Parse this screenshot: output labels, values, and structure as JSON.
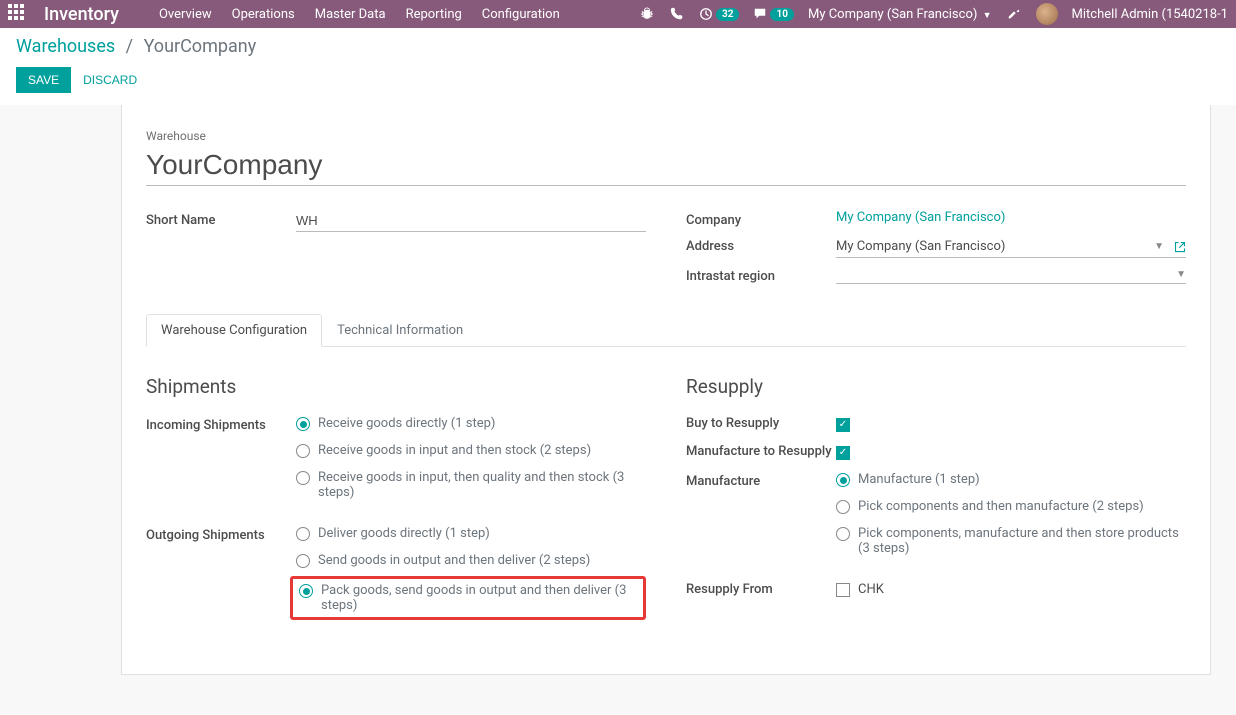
{
  "navbar": {
    "brand": "Inventory",
    "menu": [
      "Overview",
      "Operations",
      "Master Data",
      "Reporting",
      "Configuration"
    ],
    "badge_activities": "32",
    "badge_messages": "10",
    "company": "My Company (San Francisco)",
    "user": "Mitchell Admin (1540218-1"
  },
  "breadcrumb": {
    "parent": "Warehouses",
    "current": "YourCompany"
  },
  "actions": {
    "save": "SAVE",
    "discard": "DISCARD"
  },
  "form": {
    "warehouse_label": "Warehouse",
    "warehouse_value": "YourCompany",
    "short_name_label": "Short Name",
    "short_name_value": "WH",
    "company_label": "Company",
    "company_value": "My Company (San Francisco)",
    "address_label": "Address",
    "address_value": "My Company (San Francisco)",
    "intrastat_label": "Intrastat region",
    "intrastat_value": ""
  },
  "tabs": {
    "t0": "Warehouse Configuration",
    "t1": "Technical Information"
  },
  "shipments": {
    "heading": "Shipments",
    "incoming_label": "Incoming Shipments",
    "incoming_opts": [
      "Receive goods directly (1 step)",
      "Receive goods in input and then stock (2 steps)",
      "Receive goods in input, then quality and then stock (3 steps)"
    ],
    "outgoing_label": "Outgoing Shipments",
    "outgoing_opts": [
      "Deliver goods directly (1 step)",
      "Send goods in output and then deliver (2 steps)",
      "Pack goods, send goods in output and then deliver (3 steps)"
    ]
  },
  "resupply": {
    "heading": "Resupply",
    "buy_label": "Buy to Resupply",
    "manufacture_to_label": "Manufacture to Resupply",
    "manufacture_label": "Manufacture",
    "manufacture_opts": [
      "Manufacture (1 step)",
      "Pick components and then manufacture (2 steps)",
      "Pick components, manufacture and then store products (3 steps)"
    ],
    "resupply_from_label": "Resupply From",
    "resupply_from_option": "CHK"
  }
}
